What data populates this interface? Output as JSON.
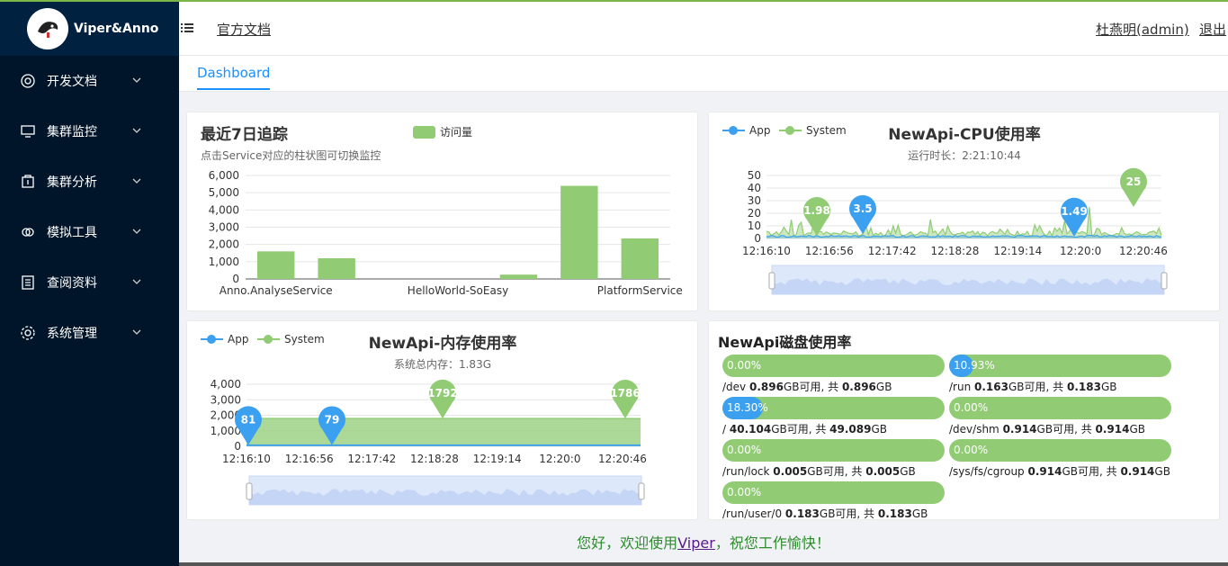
{
  "app": {
    "brand": "Viper&Anno"
  },
  "header": {
    "doc_link": "官方文档",
    "user": "杜燕明(admin)",
    "logout": "退出"
  },
  "tabs": [
    {
      "label": "Dashboard"
    }
  ],
  "sidebar": {
    "items": [
      {
        "label": "开发文档",
        "icon": "lifebuoy-icon"
      },
      {
        "label": "集群监控",
        "icon": "monitor-icon"
      },
      {
        "label": "集群分析",
        "icon": "analysis-icon"
      },
      {
        "label": "模拟工具",
        "icon": "link-icon"
      },
      {
        "label": "查阅资料",
        "icon": "book-icon"
      },
      {
        "label": "系统管理",
        "icon": "gear-icon"
      }
    ]
  },
  "colors": {
    "sidebar_bg": "#001529",
    "accent": "#1890ff",
    "green": "#91cc75",
    "blue": "#3aa0ef",
    "welcome": "#2e8b2e"
  },
  "chart_data": [
    {
      "id": "trace7",
      "type": "bar",
      "title": "最近7日追踪",
      "subtitle": "点击Service对应的柱状图可切换监控",
      "legend": [
        "访问量"
      ],
      "categories": [
        "Anno.AnalyseService",
        "",
        "",
        "HelloWorld-SoEasy",
        "",
        "",
        "PlatformService"
      ],
      "tick_labels_shown": [
        "Anno.AnalyseService",
        "HelloWorld-SoEasy",
        "PlatformService"
      ],
      "series": [
        {
          "name": "访问量",
          "values": [
            1600,
            1200,
            0,
            0,
            250,
            5400,
            2350
          ]
        }
      ],
      "ylim": [
        0,
        6000
      ],
      "yticks": [
        "6,000",
        "5,000",
        "4,000",
        "3,000",
        "2,000",
        "1,000",
        "0"
      ],
      "grid": true,
      "legend_position": "top"
    },
    {
      "id": "cpu",
      "type": "area",
      "title": "NewApi-CPU使用率",
      "subtitle": "运行时长：2:21:10:44",
      "legend": [
        "App",
        "System"
      ],
      "ylim": [
        0,
        50
      ],
      "yticks": [
        "50",
        "40",
        "30",
        "20",
        "10",
        "0"
      ],
      "xticks": [
        "12:16:10",
        "12:16:56",
        "12:17:42",
        "12:18:28",
        "12:19:14",
        "12:20:0",
        "12:20:46"
      ],
      "markers": [
        {
          "label": "1.98",
          "series": "System"
        },
        {
          "label": "3.5",
          "series": "App"
        },
        {
          "label": "1.49",
          "series": "App"
        },
        {
          "label": "25",
          "series": "System"
        }
      ],
      "dataZoom": true
    },
    {
      "id": "mem",
      "type": "area",
      "title": "NewApi-内存使用率",
      "subtitle": "系统总内存：1.83G",
      "legend": [
        "App",
        "System"
      ],
      "ylim": [
        0,
        4000
      ],
      "yticks": [
        "4,000",
        "3,000",
        "2,000",
        "1,000",
        "0"
      ],
      "xticks": [
        "12:16:10",
        "12:16:56",
        "12:17:42",
        "12:18:28",
        "12:19:14",
        "12:20:0",
        "12:20:46"
      ],
      "series": [
        {
          "name": "System",
          "values": [
            1790,
            1790,
            1792,
            1790,
            1788,
            1787,
            1786
          ]
        },
        {
          "name": "App",
          "values": [
            81,
            80,
            79,
            80,
            80,
            80,
            80
          ]
        }
      ],
      "markers": [
        {
          "label": "81",
          "series": "App"
        },
        {
          "label": "79",
          "series": "App"
        },
        {
          "label": "1792",
          "series": "System"
        },
        {
          "label": "1786",
          "series": "System"
        }
      ],
      "dataZoom": true
    }
  ],
  "disk": {
    "title": "NewApi磁盘使用率",
    "unit_text": "GB可用, 共 ",
    "gb": "GB",
    "items": [
      {
        "pct_label": "0.00%",
        "pct": 0.0,
        "mount": "/dev",
        "free": "0.896",
        "total": "0.896"
      },
      {
        "pct_label": "10.93%",
        "pct": 0.1093,
        "mount": "/run",
        "free": "0.163",
        "total": "0.183"
      },
      {
        "pct_label": "18.30%",
        "pct": 0.183,
        "mount": "/",
        "free": "40.104",
        "total": "49.089"
      },
      {
        "pct_label": "0.00%",
        "pct": 0.0,
        "mount": "/dev/shm",
        "free": "0.914",
        "total": "0.914"
      },
      {
        "pct_label": "0.00%",
        "pct": 0.0,
        "mount": "/run/lock",
        "free": "0.005",
        "total": "0.005"
      },
      {
        "pct_label": "0.00%",
        "pct": 0.0,
        "mount": "/sys/fs/cgroup",
        "free": "0.914",
        "total": "0.914"
      },
      {
        "pct_label": "0.00%",
        "pct": 0.0,
        "mount": "/run/user/0",
        "free": "0.183",
        "total": "0.183"
      }
    ]
  },
  "footer": {
    "welcome_pre": "您好，欢迎使用",
    "welcome_link": "Viper",
    "welcome_post": "，祝您工作愉快！"
  }
}
